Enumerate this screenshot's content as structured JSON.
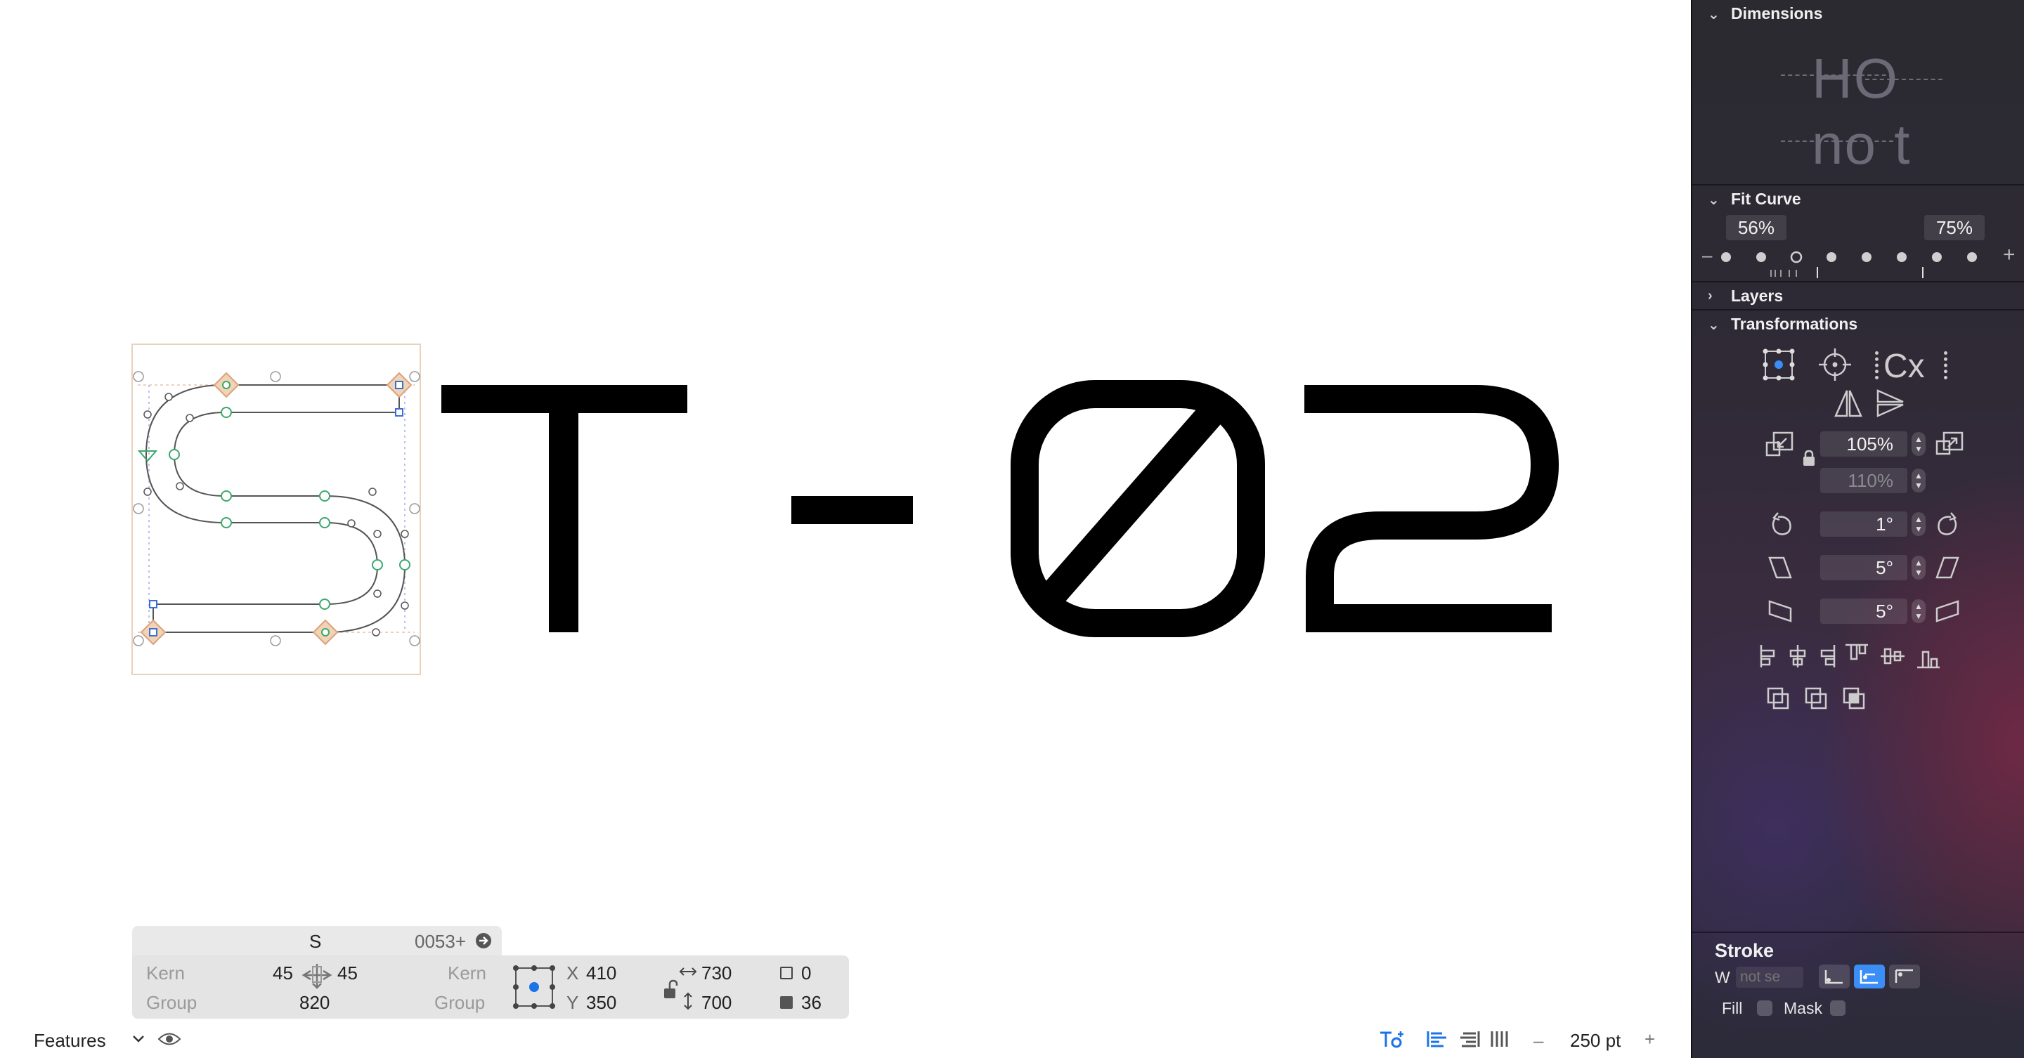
{
  "canvas": {
    "text_glyphs": [
      "T",
      "-",
      "0",
      "2"
    ],
    "selected_glyph": "S"
  },
  "info": {
    "glyph_name": "S",
    "unicode": "0053+",
    "kern_left_label": "Kern",
    "kern_right_label": "Kern",
    "group_left_label": "Group",
    "group_right_label": "Group",
    "lsb": "45",
    "rsb": "45",
    "width": "820",
    "x_label": "X",
    "x": "410",
    "y_label": "Y",
    "y": "350",
    "w_value": "730",
    "h_value": "700",
    "nodes_open": "0",
    "nodes_filled": "36"
  },
  "bottombar": {
    "features": "Features",
    "zoom_minus": "–",
    "zoom": "250 pt",
    "zoom_plus": "+"
  },
  "panel": {
    "dimensions_title": "Dimensions",
    "dimensions_preview_top": "HO",
    "dimensions_preview_bottom": "no t",
    "fitcurve_title": "Fit Curve",
    "fit_min": "56%",
    "fit_max": "75%",
    "fit_minus": "–",
    "fit_plus": "+",
    "layers_title": "Layers",
    "transform_title": "Transformations",
    "transform_cx": "Cx",
    "scale_x": "105%",
    "scale_y": "110%",
    "rotate": "1°",
    "slant": "5°",
    "skew": "5°",
    "stroke_title": "Stroke",
    "stroke_w_label": "W",
    "stroke_w_placeholder": "not se",
    "fill_label": "Fill",
    "mask_label": "Mask"
  },
  "colors": {
    "accent": "#3a8ef6",
    "node_green": "#3aa86b",
    "node_orange": "#e8a870",
    "handle_blue": "#3a6fd8"
  }
}
